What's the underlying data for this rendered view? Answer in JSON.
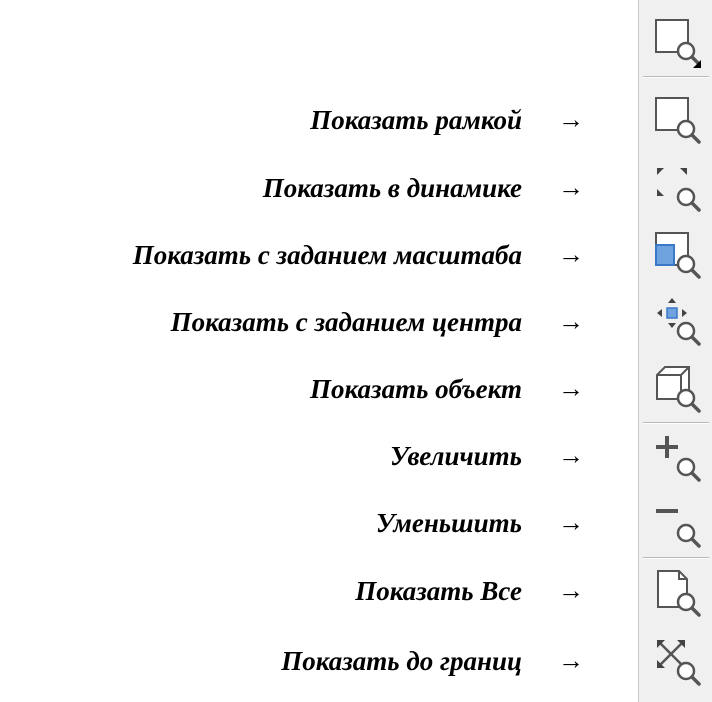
{
  "items": [
    {
      "label": "Показать  рамкой",
      "arrow": "→",
      "icon": "zoom-window-icon"
    },
    {
      "label": "Показать в динамике",
      "arrow": "→",
      "icon": "zoom-dynamic-icon"
    },
    {
      "label": "Показать с заданием масштаба",
      "arrow": "→",
      "icon": "zoom-scale-icon"
    },
    {
      "label": "Показать с заданием центра",
      "arrow": "→",
      "icon": "zoom-center-icon"
    },
    {
      "label": "Показать объект",
      "arrow": "→",
      "icon": "zoom-object-icon"
    },
    {
      "label": "Увеличить",
      "arrow": "→",
      "icon": "zoom-in-icon"
    },
    {
      "label": "Уменьшить",
      "arrow": "→",
      "icon": "zoom-out-icon"
    },
    {
      "label": "Показать Все",
      "arrow": "→",
      "icon": "zoom-all-icon"
    },
    {
      "label": "Показать до границ",
      "arrow": "→",
      "icon": "zoom-extents-icon"
    }
  ],
  "toolbar": {
    "flyout_icon": "zoom-window-flyout-icon"
  },
  "colors": {
    "icon_stroke": "#555555",
    "accent_blue": "#3a78c8",
    "toolbar_bg": "#f0f0f0"
  }
}
